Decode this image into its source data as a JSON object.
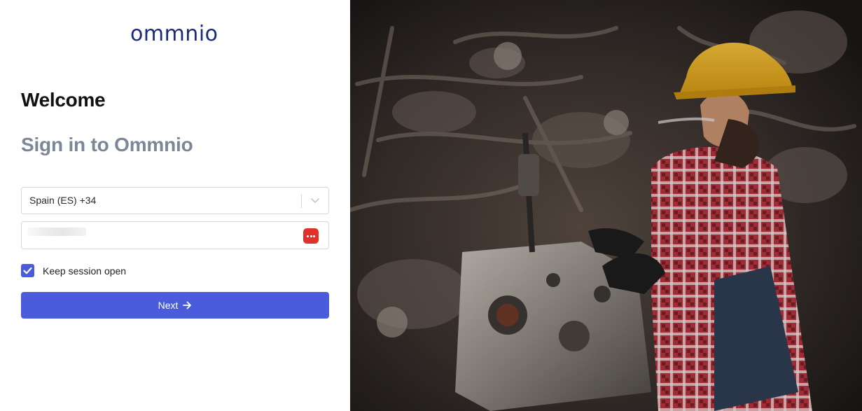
{
  "brand": {
    "logo_text": "ommnio",
    "logo_color": "#1c2a7a"
  },
  "login": {
    "heading": "Welcome",
    "subheading": "Sign in to Ommnio",
    "country_select": {
      "value": "Spain (ES) +34",
      "icon": "chevron-down-icon"
    },
    "phone_input": {
      "value": "",
      "autofill_icon": "password-manager-icon"
    },
    "keep_session": {
      "label": "Keep session open",
      "checked": true
    },
    "next_button": {
      "label": "Next",
      "icon": "arrow-right-icon"
    }
  },
  "hero_image": {
    "description_icon": "mechanic-photo"
  },
  "colors": {
    "accent": "#4a5cdc",
    "subtitle": "#7b8799",
    "autofill": "#e0322c"
  }
}
